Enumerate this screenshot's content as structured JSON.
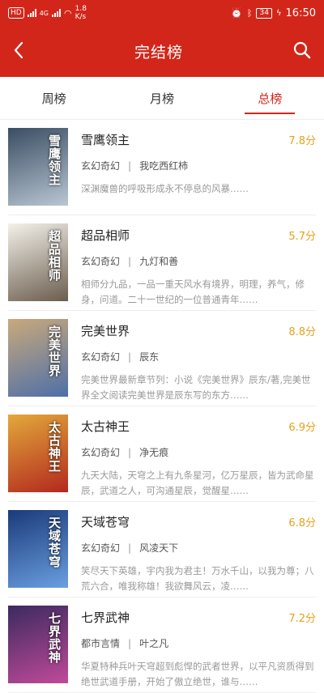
{
  "status_bar": {
    "hd_label": "HD",
    "network_label": "4G",
    "speed_value": "1.8",
    "speed_unit": "K/s",
    "battery": "34",
    "time": "16:50"
  },
  "header": {
    "title": "完结榜"
  },
  "tabs": [
    {
      "label": "周榜"
    },
    {
      "label": "月榜"
    },
    {
      "label": "总榜"
    }
  ],
  "books": [
    {
      "title": "雪鹰领主",
      "score": "7.8分",
      "genre": "玄幻奇幻",
      "author": "我吃西红柿",
      "desc": "深渊魔兽的呼吸形成永不停息的风暴……",
      "cover_text": "雪鹰领主",
      "cover_colors": [
        "#3a4d63",
        "#b9c6d3"
      ]
    },
    {
      "title": "超品相师",
      "score": "5.7分",
      "genre": "玄幻奇幻",
      "author": "九灯和善",
      "desc": "相师分九品，一品一重天风水有境界，明理，养气，修身，问道。二十一世纪的一位普通青年……",
      "cover_text": "超品相师",
      "cover_colors": [
        "#f4f1ea",
        "#6a5d4d"
      ]
    },
    {
      "title": "完美世界",
      "score": "8.8分",
      "genre": "玄幻奇幻",
      "author": "辰东",
      "desc": "完美世界最新章节列：小说《完美世界》辰东/著,完美世界全文阅读完美世界是辰东写的东方……",
      "cover_text": "完美世界",
      "cover_colors": [
        "#c9a97b",
        "#4e6fa8"
      ]
    },
    {
      "title": "太古神王",
      "score": "6.9分",
      "genre": "玄幻奇幻",
      "author": "净无痕",
      "desc": "九天大陆，天穹之上有九条星河，亿万星辰，皆为武命星辰，武道之人，可沟通星辰，觉醒星……",
      "cover_text": "太古神王",
      "cover_colors": [
        "#e2a93a",
        "#b3281e"
      ]
    },
    {
      "title": "天域苍穹",
      "score": "6.8分",
      "genre": "玄幻奇幻",
      "author": "风凌天下",
      "desc": "笑尽天下英雄，宇内我为君主！万水千山，以我为尊；八荒六合，唯我称雄！我欲舞风云，凌……",
      "cover_text": "天域苍穹",
      "cover_colors": [
        "#1b3a7a",
        "#6a9fe0"
      ]
    },
    {
      "title": "七界武神",
      "score": "7.2分",
      "genre": "都市言情",
      "author": "叶之凡",
      "desc": "华夏特种兵叶天穹超到彪悍的武者世界，以平凡资质得到绝世武道手册，开始了傲立绝世，谁与……",
      "cover_text": "七界武神",
      "cover_colors": [
        "#3b2a5e",
        "#c04a9a"
      ]
    }
  ],
  "colors": {
    "brand": "#d3261a",
    "score": "#e6a21c"
  }
}
